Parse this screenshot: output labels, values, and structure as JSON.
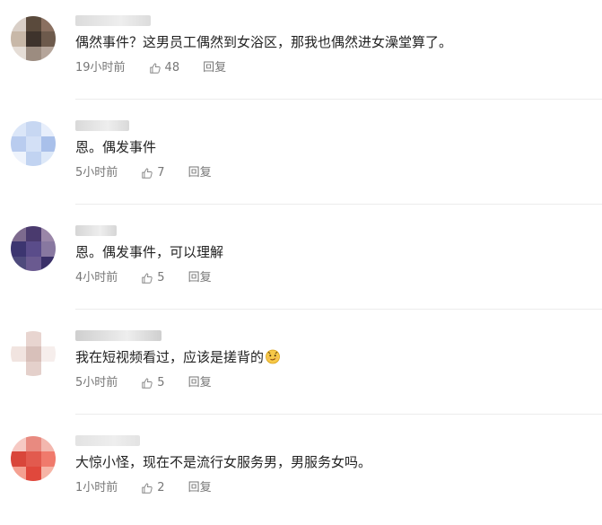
{
  "comments": [
    {
      "text": "偶然事件？这男员工偶然到女浴区，那我也偶然进女澡堂算了。",
      "time": "19小时前",
      "likes": "48",
      "reply": "回复",
      "avatar_colors": [
        "#d9cfc7",
        "#5a4a3c",
        "#8a7060",
        "#c8b8a8",
        "#3e332c",
        "#6d5a4c",
        "#e5ddd6",
        "#9c8c80",
        "#b5a59a"
      ],
      "username_color": "#dcdcdc",
      "username_width": 84
    },
    {
      "text": "恩。偶发事件",
      "time": "5小时前",
      "likes": "7",
      "reply": "回复",
      "avatar_colors": [
        "#dbe6f8",
        "#c7d7f2",
        "#e7eefb",
        "#b9ccef",
        "#d3e0f6",
        "#a9c0ea",
        "#eef3fc",
        "#c1d3f1",
        "#dde8f8"
      ],
      "username_color": "#d9d9d9",
      "username_width": 60
    },
    {
      "text": "恩。偶发事件，可以理解",
      "time": "4小时前",
      "likes": "5",
      "reply": "回复",
      "avatar_colors": [
        "#7d6a8e",
        "#4a3a6e",
        "#9a86a8",
        "#3c3570",
        "#5a4c8a",
        "#8878a0",
        "#4e4a7c",
        "#6a5a90",
        "#3a3068"
      ],
      "username_color": "#d6d6d6",
      "username_width": 46
    },
    {
      "text": "我在短视频看过，应该是搓背的",
      "time": "5小时前",
      "likes": "5",
      "reply": "回复",
      "avatar_colors": [
        "#ffffff",
        "#e8d5d0",
        "#ffffff",
        "#f1e4e0",
        "#d8c0ba",
        "#f6eeec",
        "#ffffff",
        "#e4d0cb",
        "#ffffff"
      ],
      "username_color": "#cfcfcf",
      "username_width": 96
    },
    {
      "text": "大惊小怪，现在不是流行女服务男，男服务女吗。",
      "time": "1小时前",
      "likes": "2",
      "reply": "回复",
      "avatar_colors": [
        "#f6c9c3",
        "#e88a80",
        "#f3b7ae",
        "#d9463a",
        "#e25a4e",
        "#f07a6c",
        "#f4a091",
        "#e0483c",
        "#f6b4a6"
      ],
      "username_color": "#e3e3e3",
      "username_width": 72
    }
  ]
}
